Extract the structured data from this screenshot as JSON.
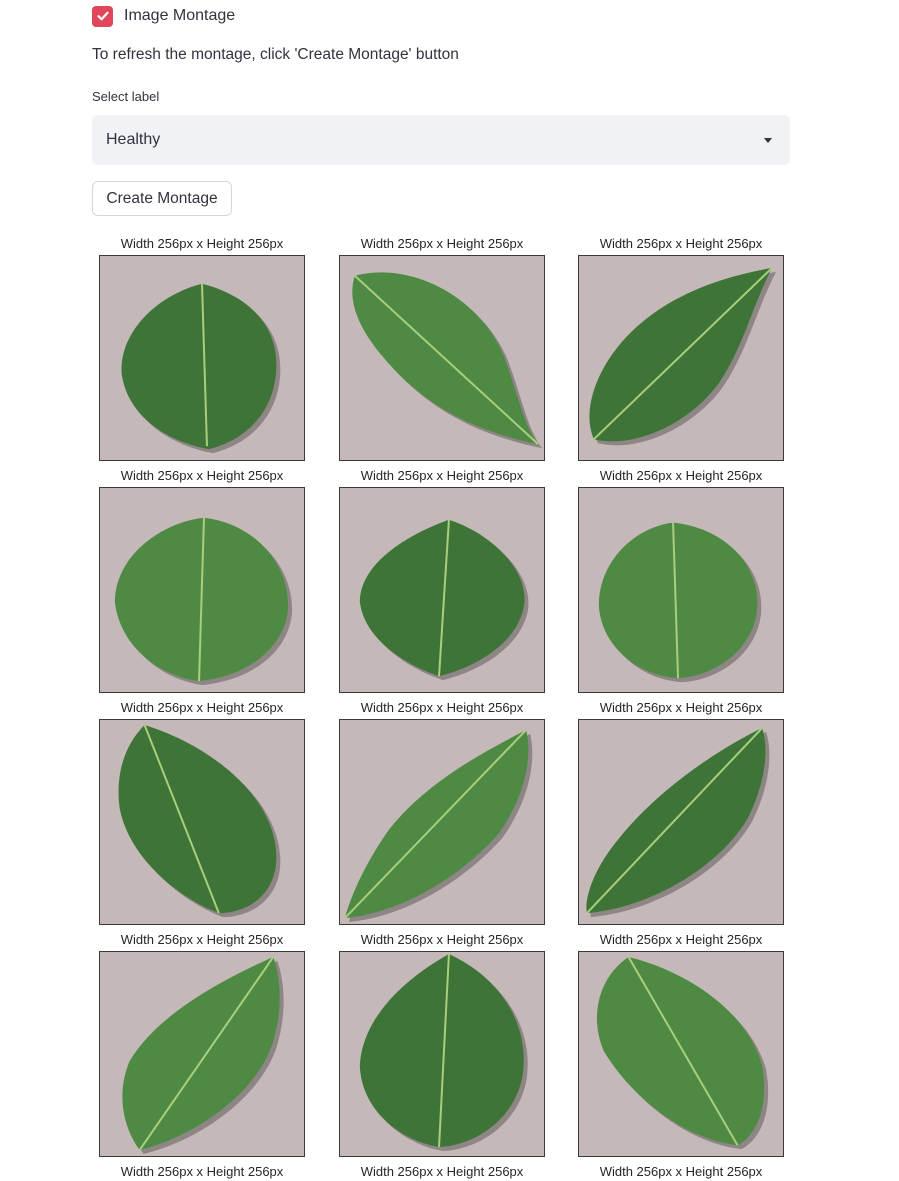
{
  "checkbox": {
    "label": "Image Montage",
    "checked": true,
    "color": "#e0475a"
  },
  "refresh_text": "To refresh the montage, click 'Create Montage' button",
  "select": {
    "label": "Select label",
    "value": "Healthy"
  },
  "create_button": {
    "label": "Create Montage"
  },
  "montage": {
    "title_text": "Width 256px x Height 256px",
    "rows": 4,
    "cols": 3,
    "image_content": "leaf-image",
    "bottom_captions": [
      "Width 256px x Height 256px",
      "Width 256px x Height 256px",
      "Width 256px x Height 256px"
    ]
  },
  "colors": {
    "leaf": "#4f8a45",
    "leaf_dark": "#3f7438",
    "vein": "#a9cf7c",
    "background": "#c4b9b8",
    "select_bg": "#f0f2f6",
    "text": "#31333f"
  }
}
